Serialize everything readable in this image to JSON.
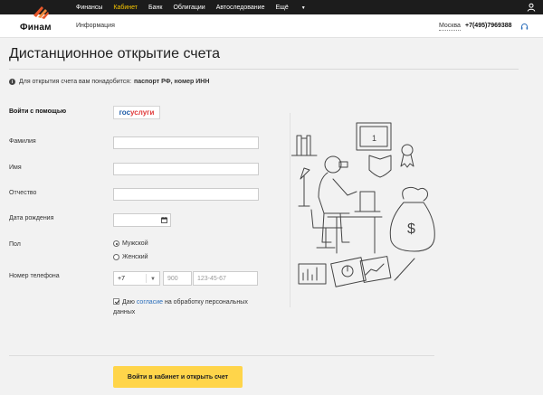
{
  "topnav": {
    "items": [
      {
        "label": "Финансы",
        "active": false
      },
      {
        "label": "Кабинет",
        "active": true
      },
      {
        "label": "Банк",
        "active": false
      },
      {
        "label": "Облигации",
        "active": false
      },
      {
        "label": "Автоследование",
        "active": false
      },
      {
        "label": "Ещё",
        "active": false
      }
    ],
    "user_icon": "user-icon",
    "active_color": "#f5c400"
  },
  "header": {
    "logo_text": "Финам",
    "info_link": "Информация",
    "city": "Москва",
    "phone": "+7(495)7969388",
    "headset_icon": "headset-icon"
  },
  "page": {
    "title": "Дистанционное открытие счета",
    "note_prefix": "Для открытия счета вам понадобится:",
    "note_docs": "паспорт РФ, номер ИНН"
  },
  "form": {
    "login_with_label": "Войти с помощью",
    "gosuslugi": {
      "part1": "гос",
      "part2": "услуги"
    },
    "lastname_label": "Фамилия",
    "lastname_value": "",
    "firstname_label": "Имя",
    "firstname_value": "",
    "middlename_label": "Отчество",
    "middlename_value": "",
    "birthdate_label": "Дата рождения",
    "gender_label": "Пол",
    "gender_options": [
      "Мужской",
      "Женский"
    ],
    "gender_selected": "Мужской",
    "phone_label": "Номер телефона",
    "phone_country_code": "+7",
    "phone_area_placeholder": "900",
    "phone_number_placeholder": "123-45-67",
    "consent_prefix": "Даю",
    "consent_link": "согласие",
    "consent_suffix": "на обработку персональных данных",
    "consent_checked": true,
    "submit_label": "Войти в кабинет и открыть счет"
  },
  "colors": {
    "submit_bg": "#ffd54a",
    "link": "#2a6ebb",
    "gos_blue": "#1c5aa6",
    "gos_red": "#e03a3a",
    "logo_orange": "#e8572a"
  }
}
